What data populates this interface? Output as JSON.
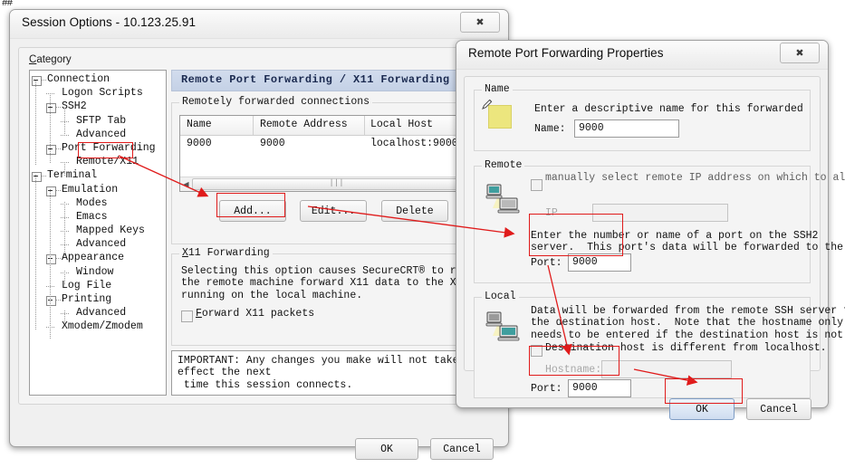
{
  "artifact_text": "##",
  "session_options": {
    "title": "Session Options - 10.123.25.91",
    "close_glyph": "✖",
    "category_label": "Category",
    "tree": [
      {
        "label": "Connection",
        "depth": 0,
        "expander": true
      },
      {
        "label": "Logon Scripts",
        "depth": 1,
        "expander": false
      },
      {
        "label": "SSH2",
        "depth": 1,
        "expander": true
      },
      {
        "label": "SFTP Tab",
        "depth": 2,
        "expander": false
      },
      {
        "label": "Advanced",
        "depth": 2,
        "expander": false
      },
      {
        "label": "Port Forwarding",
        "depth": 1,
        "expander": true
      },
      {
        "label": "Remote/X11",
        "depth": 2,
        "expander": false,
        "selected": true
      },
      {
        "label": "Terminal",
        "depth": 0,
        "expander": true
      },
      {
        "label": "Emulation",
        "depth": 1,
        "expander": true
      },
      {
        "label": "Modes",
        "depth": 2,
        "expander": false
      },
      {
        "label": "Emacs",
        "depth": 2,
        "expander": false
      },
      {
        "label": "Mapped Keys",
        "depth": 2,
        "expander": false
      },
      {
        "label": "Advanced",
        "depth": 2,
        "expander": false
      },
      {
        "label": "Appearance",
        "depth": 1,
        "expander": true
      },
      {
        "label": "Window",
        "depth": 2,
        "expander": false
      },
      {
        "label": "Log File",
        "depth": 1,
        "expander": false
      },
      {
        "label": "Printing",
        "depth": 1,
        "expander": true
      },
      {
        "label": "Advanced",
        "depth": 2,
        "expander": false
      },
      {
        "label": "Xmodem/Zmodem",
        "depth": 1,
        "expander": false
      }
    ],
    "pane_header": "Remote Port Forwarding / X11 Forwarding",
    "connections_group_title": "Remotely forwarded connections",
    "table": {
      "columns": [
        "Name",
        "Remote Address",
        "Local Host"
      ],
      "rows": [
        [
          "9000",
          "9000",
          "localhost:9000"
        ]
      ]
    },
    "buttons": {
      "add": "Add...",
      "edit": "Edit...",
      "delete": "Delete"
    },
    "x11_group_title": "X11 Forwarding",
    "x11_description": "Selecting this option causes SecureCRT® to request\nthe remote machine forward X11 data to the X server\nrunning on the local machine.",
    "x11_checkbox_label": "Forward X11 packets",
    "x11_checkbox_checked": false,
    "important_note": "IMPORTANT: Any changes you make will not take effect the next\n time this session connects.",
    "ok": "OK",
    "cancel": "Cancel"
  },
  "properties": {
    "title": "Remote Port Forwarding Properties",
    "close_glyph": "✖",
    "name_group": {
      "title": "Name",
      "icon": "yellow-note-pencil-icon",
      "description": "Enter a descriptive name for this forwarded",
      "field_label": "Name:",
      "field_value": "9000"
    },
    "remote_group": {
      "title": "Remote",
      "icon": "two-computers-icon",
      "checkbox_label": "manually select remote IP address on which to allow",
      "checkbox_checked": false,
      "ip_label": "IP",
      "ip_value": "",
      "description": "Enter the number or name of a port on the SSH2\nserver.  This port's data will be forwarded to the",
      "port_label": "Port:",
      "port_value": "9000"
    },
    "local_group": {
      "title": "Local",
      "icon": "two-computers-icon",
      "description": "Data will be forwarded from the remote SSH server to\nthe destination host.  Note that the hostname only\nneeds to be entered if the destination host is not",
      "checkbox_label": "Destination host is different from localhost.",
      "checkbox_checked": false,
      "hostname_label": "Hostname:",
      "hostname_value": "",
      "port_label": "Port:",
      "port_value": "9000"
    },
    "ok": "OK",
    "cancel": "Cancel"
  },
  "annotations": {
    "accent_color": "#e01b1b",
    "highlight_boxes": [
      "tree-remote-x11",
      "add-button",
      "remote-port-field",
      "local-port-field",
      "ok-button"
    ]
  }
}
